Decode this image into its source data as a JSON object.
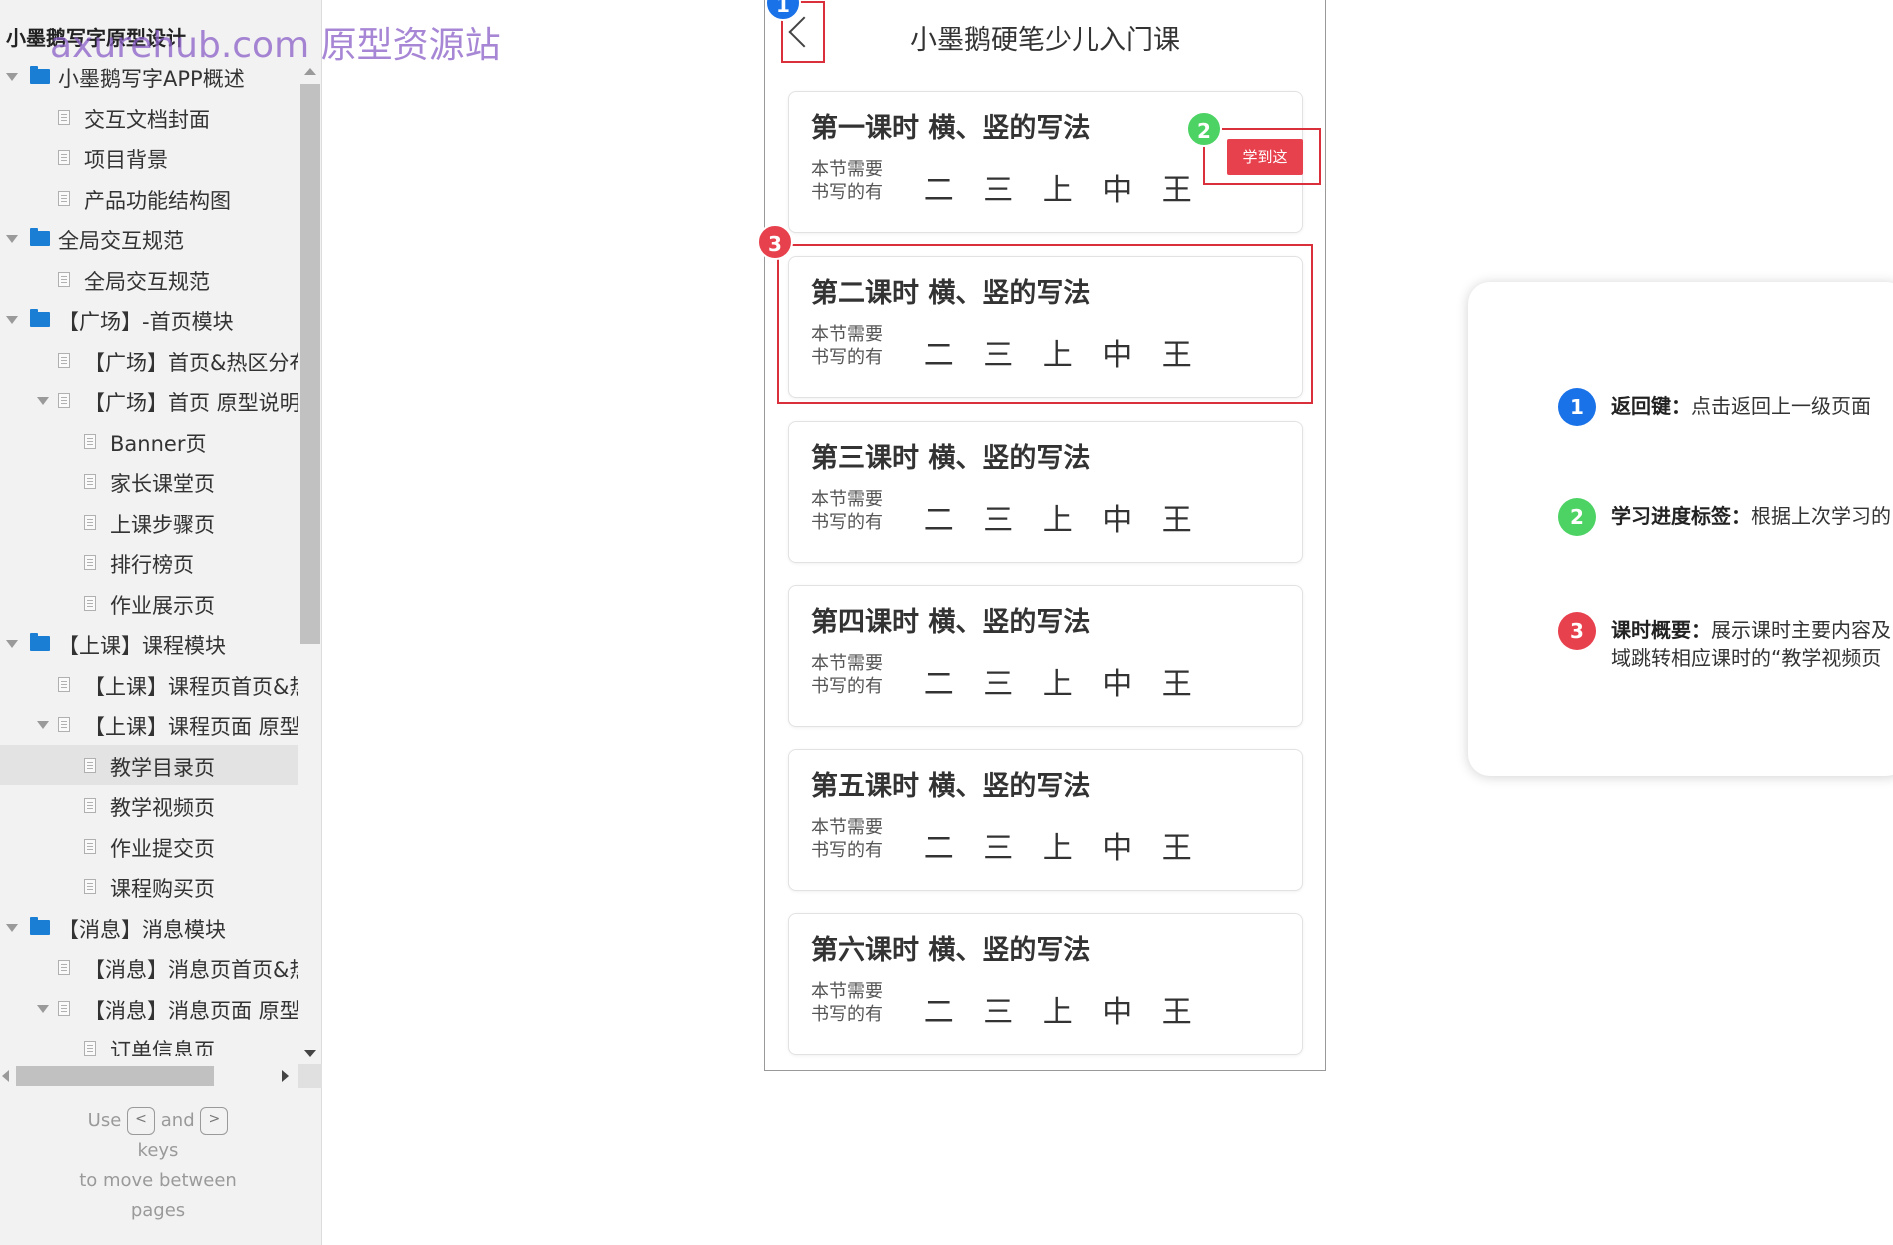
{
  "sidebar": {
    "project_title": "小墨鹅写字原型设计",
    "watermark": "axurehub.com 原型资源站",
    "tree": [
      {
        "label": "小墨鹅写字APP概述",
        "type": "folder",
        "level": 0,
        "expanded": true
      },
      {
        "label": "交互文档封面",
        "type": "page",
        "level": 1
      },
      {
        "label": "项目背景",
        "type": "page",
        "level": 1
      },
      {
        "label": "产品功能结构图",
        "type": "page",
        "level": 1
      },
      {
        "label": "全局交互规范",
        "type": "folder",
        "level": 0,
        "expanded": true
      },
      {
        "label": "全局交互规范",
        "type": "page",
        "level": 1
      },
      {
        "label": "【广场】-首页模块",
        "type": "folder",
        "level": 0,
        "expanded": true
      },
      {
        "label": "【广场】首页&热区分布",
        "type": "page",
        "level": 1
      },
      {
        "label": "【广场】首页 原型说明",
        "type": "page",
        "level": 1,
        "expanded": true
      },
      {
        "label": "Banner页",
        "type": "page",
        "level": 2
      },
      {
        "label": "家长课堂页",
        "type": "page",
        "level": 2
      },
      {
        "label": "上课步骤页",
        "type": "page",
        "level": 2
      },
      {
        "label": "排行榜页",
        "type": "page",
        "level": 2
      },
      {
        "label": "作业展示页",
        "type": "page",
        "level": 2
      },
      {
        "label": "【上课】课程模块",
        "type": "folder",
        "level": 0,
        "expanded": true
      },
      {
        "label": "【上课】课程页首页&热区分布",
        "type": "page",
        "level": 1
      },
      {
        "label": "【上课】课程页面 原型说明",
        "type": "page",
        "level": 1,
        "expanded": true
      },
      {
        "label": "教学目录页",
        "type": "page",
        "level": 2,
        "selected": true
      },
      {
        "label": "教学视频页",
        "type": "page",
        "level": 2
      },
      {
        "label": "作业提交页",
        "type": "page",
        "level": 2
      },
      {
        "label": "课程购买页",
        "type": "page",
        "level": 2
      },
      {
        "label": "【消息】消息模块",
        "type": "folder",
        "level": 0,
        "expanded": true
      },
      {
        "label": "【消息】消息页首页&热区分布",
        "type": "page",
        "level": 1
      },
      {
        "label": "【消息】消息页面 原型说明",
        "type": "page",
        "level": 1,
        "expanded": true
      },
      {
        "label": "订单信息页",
        "type": "page",
        "level": 2
      }
    ],
    "key_help": {
      "use": "Use",
      "and": "and",
      "keys": "keys",
      "line": "to move between",
      "pages": "pages",
      "left_key": "<",
      "right_key": ">"
    }
  },
  "phone": {
    "back_icon": "chevron-left-icon",
    "title": "小墨鹅硬笔少儿入门课",
    "learn_button": "学到这",
    "lessons": [
      {
        "title": "第一课时 横、竖的写法",
        "sub": "本节需要书写的有",
        "chars": [
          "二",
          "三",
          "上",
          "中",
          "王"
        ]
      },
      {
        "title": "第二课时 横、竖的写法",
        "sub": "本节需要书写的有",
        "chars": [
          "二",
          "三",
          "上",
          "中",
          "王"
        ]
      },
      {
        "title": "第三课时 横、竖的写法",
        "sub": "本节需要书写的有",
        "chars": [
          "二",
          "三",
          "上",
          "中",
          "王"
        ]
      },
      {
        "title": "第四课时 横、竖的写法",
        "sub": "本节需要书写的有",
        "chars": [
          "二",
          "三",
          "上",
          "中",
          "王"
        ]
      },
      {
        "title": "第五课时 横、竖的写法",
        "sub": "本节需要书写的有",
        "chars": [
          "二",
          "三",
          "上",
          "中",
          "王"
        ]
      },
      {
        "title": "第六课时 横、竖的写法",
        "sub": "本节需要书写的有",
        "chars": [
          "二",
          "三",
          "上",
          "中",
          "王"
        ]
      }
    ],
    "badges": {
      "b1": "1",
      "b2": "2",
      "b3": "3"
    }
  },
  "notes": [
    {
      "num": "1",
      "label": "返回键：",
      "text": "点击返回上一级页面",
      "text2": "",
      "color": "#1a72e8"
    },
    {
      "num": "2",
      "label": "学习进度标签：",
      "text": "根据上次学习的",
      "text2": "",
      "color": "#4cd364"
    },
    {
      "num": "3",
      "label": "课时概要：",
      "text": "展示课时主要内容及",
      "text2": "域跳转相应课时的“教学视频页",
      "color": "#e8414e"
    }
  ],
  "colors": {
    "accent_red": "#e8414e",
    "highlight_red": "#d9303b",
    "folder_blue": "#1a7fd4"
  }
}
